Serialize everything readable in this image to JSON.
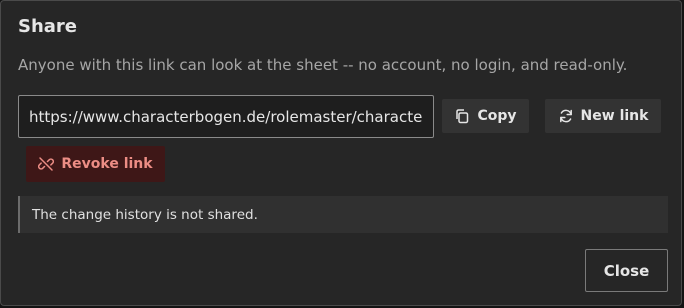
{
  "dialog": {
    "title": "Share",
    "description": "Anyone with this link can look at the sheet -- no account, no login, and read-only.",
    "link_value": "https://www.characterbogen.de/rolemaster/character/share/",
    "copy_label": "Copy",
    "copy_icon": "copy-icon",
    "new_link_label": "New link",
    "new_link_icon": "refresh-icon",
    "revoke_label": "Revoke link",
    "revoke_icon": "link-off-icon",
    "notice": "The change history is not shared.",
    "close_label": "Close"
  },
  "colors": {
    "dialog_bg": "#262626",
    "revoke_bg": "#3e1717",
    "revoke_text": "#ec8d85"
  }
}
